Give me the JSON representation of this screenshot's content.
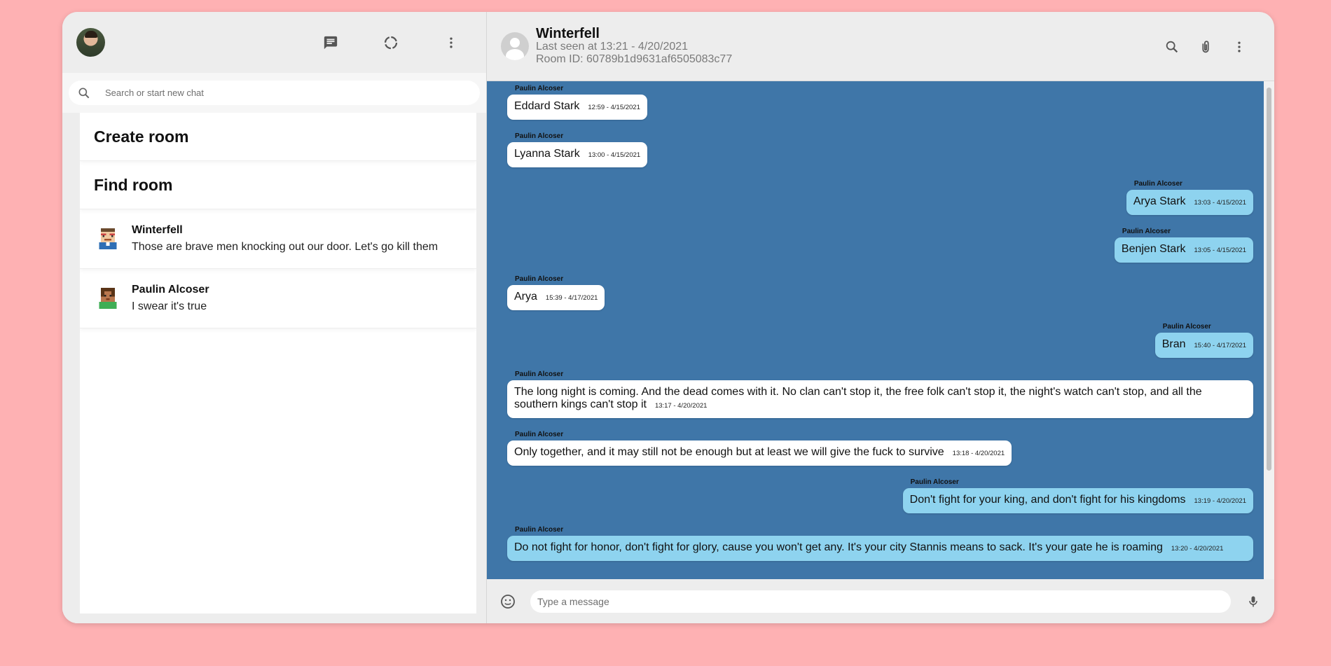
{
  "sidebar": {
    "search_placeholder": "Search or start new chat",
    "create_room": "Create room",
    "find_room": "Find room",
    "chats": [
      {
        "name": "Winterfell",
        "last": "Those are brave men knocking out our door. Let's go kill them"
      },
      {
        "name": "Paulin Alcoser",
        "last": "I swear it's true"
      }
    ]
  },
  "header": {
    "title": "Winterfell",
    "last_seen": "Last seen at 13:21 - 4/20/2021",
    "room_id": "Room ID: 60789b1d9631af6505083c77"
  },
  "messages": [
    {
      "author": "Paulin Alcoser",
      "text": "Eddard Stark",
      "time": "12:59 - 4/15/2021",
      "dir": "in"
    },
    {
      "author": "Paulin Alcoser",
      "text": "Lyanna Stark",
      "time": "13:00 - 4/15/2021",
      "dir": "in"
    },
    {
      "author": "Paulin Alcoser",
      "text": "Arya Stark",
      "time": "13:03 - 4/15/2021",
      "dir": "out"
    },
    {
      "author": "Paulin Alcoser",
      "text": "Benjen Stark",
      "time": "13:05 - 4/15/2021",
      "dir": "out"
    },
    {
      "author": "Paulin Alcoser",
      "text": "Arya",
      "time": "15:39 - 4/17/2021",
      "dir": "in"
    },
    {
      "author": "Paulin Alcoser",
      "text": "Bran",
      "time": "15:40 - 4/17/2021",
      "dir": "out"
    },
    {
      "author": "Paulin Alcoser",
      "text": "The long night is coming. And the dead comes with it. No clan can't stop it, the free folk can't stop it, the night's watch can't stop, and all the southern kings can't stop it",
      "time": "13:17 - 4/20/2021",
      "dir": "in"
    },
    {
      "author": "Paulin Alcoser",
      "text": "Only together, and it may still not be enough but at least we will give the fuck to survive",
      "time": "13:18 - 4/20/2021",
      "dir": "in"
    },
    {
      "author": "Paulin Alcoser",
      "text": "Don't fight for your king, and don't fight for his kingdoms",
      "time": "13:19 - 4/20/2021",
      "dir": "out"
    },
    {
      "author": "Paulin Alcoser",
      "text": "Do not fight for honor, don't fight for glory, cause you won't get any. It's your city Stannis means to sack. It's your gate he is roaming",
      "time": "13:20 - 4/20/2021",
      "dir": "out"
    }
  ],
  "composer": {
    "placeholder": "Type a message"
  },
  "colors": {
    "background": "#feb1b3",
    "chat_bg": "#3f76a8",
    "outgoing": "#8ed3ef",
    "incoming": "#ffffff"
  },
  "icons": [
    "chat-icon",
    "status-icon",
    "more-vert-icon",
    "search-icon",
    "attach-icon",
    "emoji-icon",
    "mic-icon"
  ]
}
